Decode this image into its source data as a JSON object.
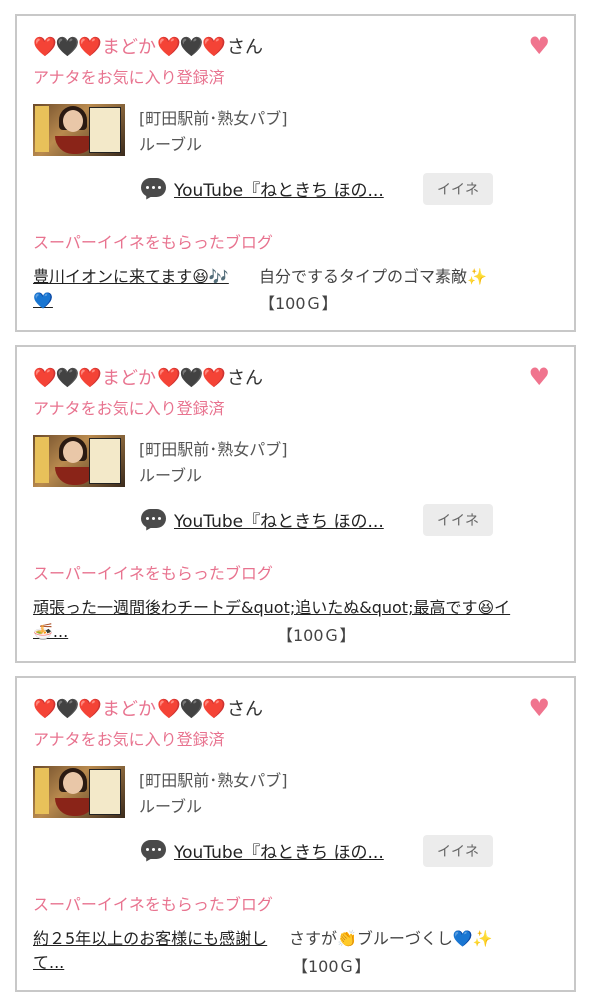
{
  "cards": [
    {
      "user_prefix": "❤️🖤❤️",
      "user_name": "まどか",
      "user_suffix": "❤️🖤❤️",
      "honorific": "さん",
      "favorite_status": "アナタをお気に入り登録済",
      "shop_area": "[町田駅前･熟女パブ]",
      "shop_name": "ルーブル",
      "youtube_title": "YouTube『ねときち ほの...",
      "like_label": "イイネ",
      "super_like_label": "スーパーイイネをもらったブログ",
      "blog_title": "豊川イオンに来てます😆🎶💙",
      "blog_desc": "自分でするタイプのゴマ素敵✨",
      "blog_price": "【100Ｇ】"
    },
    {
      "user_prefix": "❤️🖤❤️",
      "user_name": "まどか",
      "user_suffix": "❤️🖤❤️",
      "honorific": "さん",
      "favorite_status": "アナタをお気に入り登録済",
      "shop_area": "[町田駅前･熟女パブ]",
      "shop_name": "ルーブル",
      "youtube_title": "YouTube『ねときち ほの...",
      "like_label": "イイネ",
      "super_like_label": "スーパーイイネをもらったブログ",
      "blog_title": "頑張った一週間後わチートデ&quot;追いたぬ&quot;最高です😆イ🍜...",
      "blog_desc": "",
      "blog_price": "【100Ｇ】"
    },
    {
      "user_prefix": "❤️🖤❤️",
      "user_name": "まどか",
      "user_suffix": "❤️🖤❤️",
      "honorific": "さん",
      "favorite_status": "アナタをお気に入り登録済",
      "shop_area": "[町田駅前･熟女パブ]",
      "shop_name": "ルーブル",
      "youtube_title": "YouTube『ねときち ほの...",
      "like_label": "イイネ",
      "super_like_label": "スーパーイイネをもらったブログ",
      "blog_title": "約２5年以上のお客様にも感謝して...",
      "blog_desc": "さすが👏ブルーづくし💙✨",
      "blog_price": "【100Ｇ】"
    }
  ],
  "icons": {
    "favorite": "heart-icon",
    "comment": "chat-bubble-icon"
  },
  "colors": {
    "accent_pink": "#e8738f",
    "heart_pink": "#f0748e",
    "border": "#c8c8c8",
    "button_bg": "#ececec"
  }
}
